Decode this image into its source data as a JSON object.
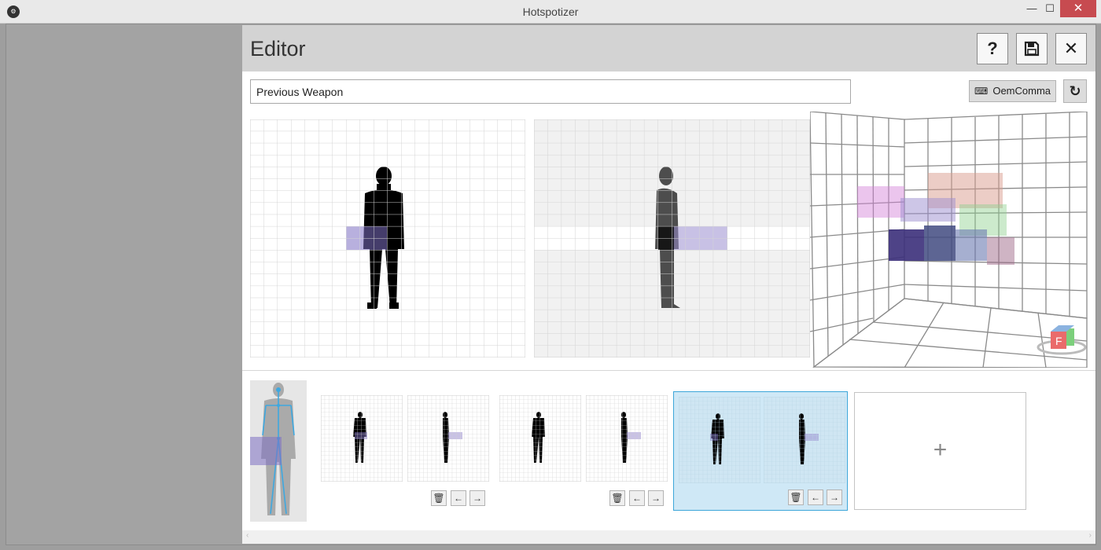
{
  "window": {
    "title": "Hotspotizer",
    "icon": "app-logo-icon",
    "controls": {
      "minimize": "—",
      "maximize": "☐",
      "close": "✕"
    }
  },
  "editor": {
    "title": "Editor",
    "buttons": {
      "help": "?",
      "save_icon": "floppy-disk-icon",
      "close": "✕"
    },
    "gesture_name": "Previous Weapon",
    "key_binding": "OemComma",
    "key_icon": "keyboard-icon",
    "refresh_icon": "refresh-icon",
    "refresh_glyph": "↻",
    "add_symbol": "+",
    "control_glyphs": {
      "delete": "🗑",
      "left": "←",
      "right": "→"
    },
    "colors": {
      "selection_fill": "#cfe8f6",
      "selection_border": "#3ca6d9",
      "hotspot": "#9b8ed0"
    }
  }
}
